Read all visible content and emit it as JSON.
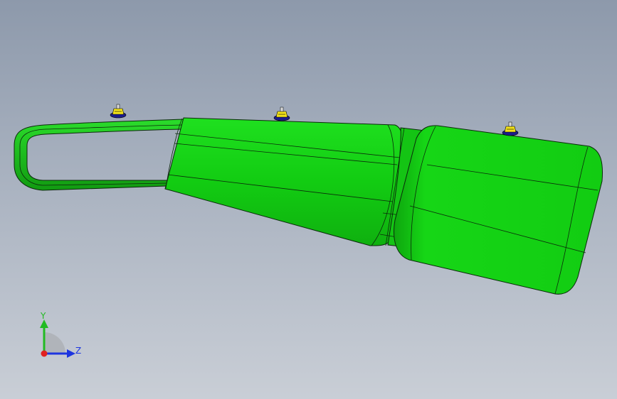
{
  "viewport": {
    "background_top": "#8d99ab",
    "background_bottom": "#c9ced6"
  },
  "model": {
    "part_color": "#12cc12",
    "edge_color": "#0b2a0b",
    "marker_count": 3,
    "marker_icon": "point-marker-icon"
  },
  "triad": {
    "y_label": "Y",
    "z_label": "Z",
    "y_color": "#22bb22",
    "z_color": "#1d35e0",
    "x_color": "#e02020"
  }
}
